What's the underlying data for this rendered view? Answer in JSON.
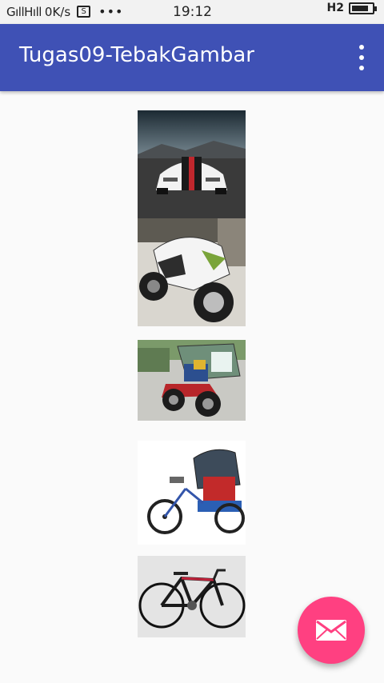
{
  "status_bar": {
    "signal": "GıllHıll",
    "speed": "0K/s",
    "sim_icon": "S",
    "dots": "•••",
    "time": "19:12",
    "network": "H2",
    "battery_level": 0.85
  },
  "app_bar": {
    "title": "Tugas09-TebakGambar",
    "overflow_icon": "more-vert-icon"
  },
  "images": [
    {
      "subject": "car-image"
    },
    {
      "subject": "motorcycle-image"
    },
    {
      "subject": "becak-motor-image"
    },
    {
      "subject": "becak-image"
    },
    {
      "subject": "bicycle-image"
    }
  ],
  "fab": {
    "icon": "email-icon",
    "color": "#ff4081"
  },
  "colors": {
    "primary": "#3f51b5",
    "accent": "#ff4081"
  }
}
